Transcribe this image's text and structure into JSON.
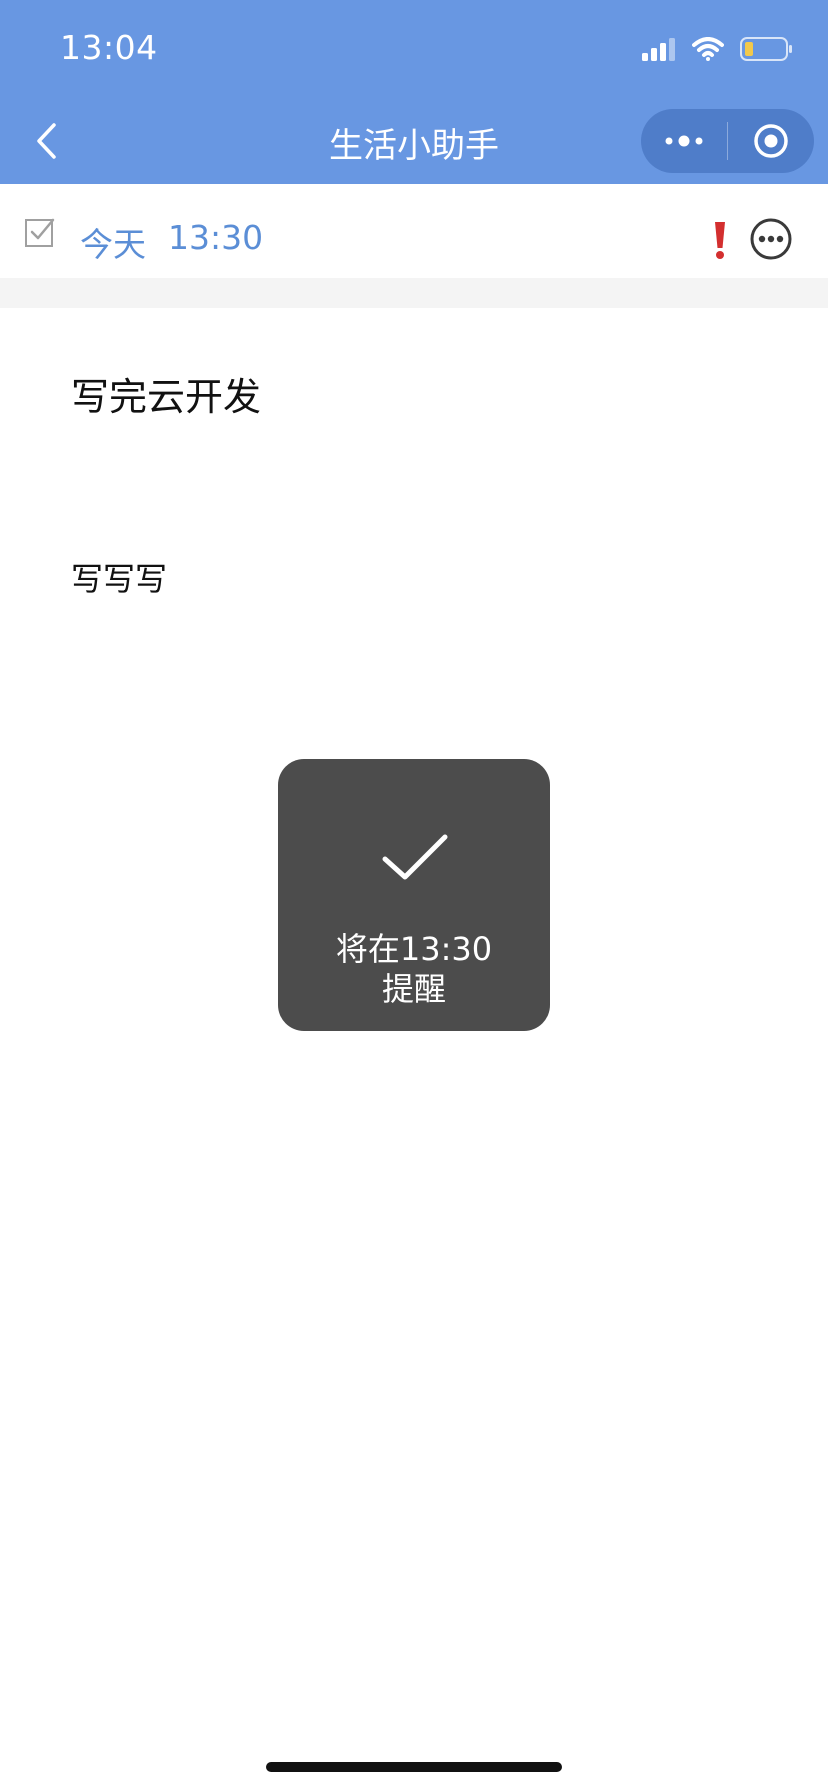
{
  "status_bar": {
    "time": "13:04",
    "icons": [
      "signal-icon",
      "wifi-icon",
      "battery-icon"
    ],
    "battery_color": "#f2c94c"
  },
  "nav_bar": {
    "title": "生活小助手",
    "background": "#6897e2",
    "icons": [
      "back-icon",
      "more-dots-icon",
      "target-icon"
    ]
  },
  "toolbar": {
    "date": "今天",
    "time": "13:30",
    "accent": "#5b8ed6",
    "priority_color": "#d32f2f",
    "icons": [
      "checkbox-icon",
      "priority-icon",
      "more-icon"
    ]
  },
  "note": {
    "title": "写完云开发",
    "body": "写写写"
  },
  "toast": {
    "line1": "将在13:30",
    "line2": "提醒",
    "icon": "check-icon"
  }
}
